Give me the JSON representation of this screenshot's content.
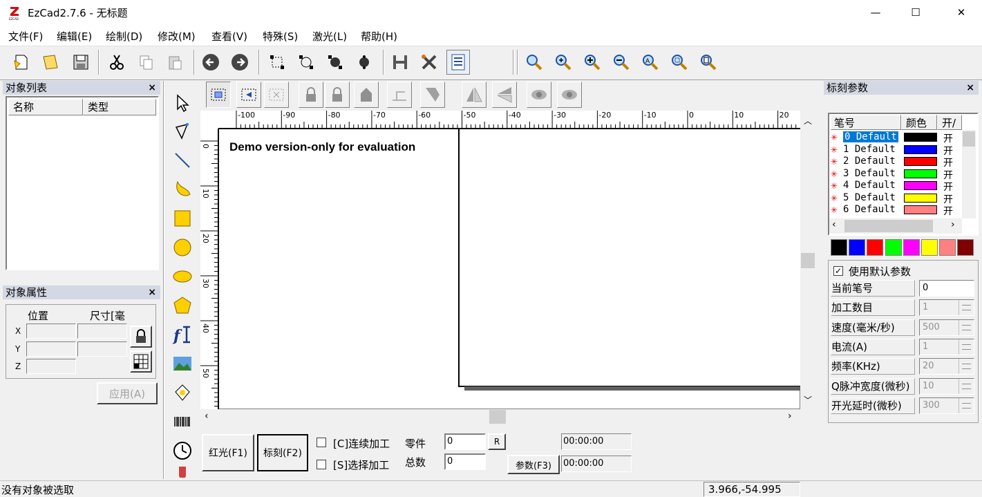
{
  "window": {
    "title": "EzCad2.7.6 - 无标题",
    "minimize": "—",
    "maximize": "☐",
    "close": "✕"
  },
  "menu": [
    "文件(F)",
    "编辑(E)",
    "绘制(D)",
    "修改(M)",
    "查看(V)",
    "特殊(S)",
    "激光(L)",
    "帮助(H)"
  ],
  "object_list": {
    "title": "对象列表",
    "close": "×",
    "col_name": "名称",
    "col_type": "类型"
  },
  "object_props": {
    "title": "对象属性",
    "close": "×",
    "pos_label": "位置",
    "size_label": "尺寸[毫",
    "x": "X",
    "y": "Y",
    "z": "Z",
    "apply": "应用(A)"
  },
  "canvas": {
    "watermark": "Demo version-only for evaluation",
    "hticks": [
      "-100",
      "-90",
      "-80",
      "-70",
      "-60",
      "-50",
      "-40",
      "-30",
      "-20",
      "-10",
      "0",
      "10",
      "20"
    ],
    "vticks": [
      "0",
      "10",
      "20",
      "30",
      "40",
      "50"
    ]
  },
  "bottom": {
    "red_btn": "红光(F1)",
    "mark_btn": "标刻(F2)",
    "continuous": "[C]连续加工",
    "select_proc": "[S]选择加工",
    "parts_label": "零件",
    "total_label": "总数",
    "parts_val": "0",
    "total_val": "0",
    "r_btn": "R",
    "time1": "00:00:00",
    "time2": "00:00:00",
    "param_btn": "参数(F3)"
  },
  "mark_params": {
    "title": "标刻参数",
    "close": "×",
    "col_pen": "笔号",
    "col_color": "颜色",
    "col_onoff": "开/",
    "pens": [
      {
        "name": "0 Default",
        "color": "#000000",
        "on": "开"
      },
      {
        "name": "1 Default",
        "color": "#0000ff",
        "on": "开"
      },
      {
        "name": "2 Default",
        "color": "#ff0000",
        "on": "开"
      },
      {
        "name": "3 Default",
        "color": "#00ff00",
        "on": "开"
      },
      {
        "name": "4 Default",
        "color": "#ff00ff",
        "on": "开"
      },
      {
        "name": "5 Default",
        "color": "#ffff00",
        "on": "开"
      },
      {
        "name": "6 Default",
        "color": "#ff8080",
        "on": "开"
      }
    ],
    "palette": [
      "#000000",
      "#0000ff",
      "#ff0000",
      "#00ff00",
      "#ff00ff",
      "#ffff00",
      "#ff8080",
      "#800000"
    ],
    "use_default": "使用默认参数",
    "params": [
      {
        "label": "当前笔号",
        "value": "0"
      },
      {
        "label": "加工数目",
        "value": "1"
      },
      {
        "label": "速度(毫米/秒)",
        "value": "500"
      },
      {
        "label": "电流(A)",
        "value": "1"
      },
      {
        "label": "频率(KHz)",
        "value": "20"
      },
      {
        "label": "Q脉冲宽度(微秒)",
        "value": "10"
      },
      {
        "label": "开光延时(微秒)",
        "value": "300"
      }
    ]
  },
  "status": {
    "left": "没有对象被选取",
    "coords": "3.966,-54.995"
  }
}
